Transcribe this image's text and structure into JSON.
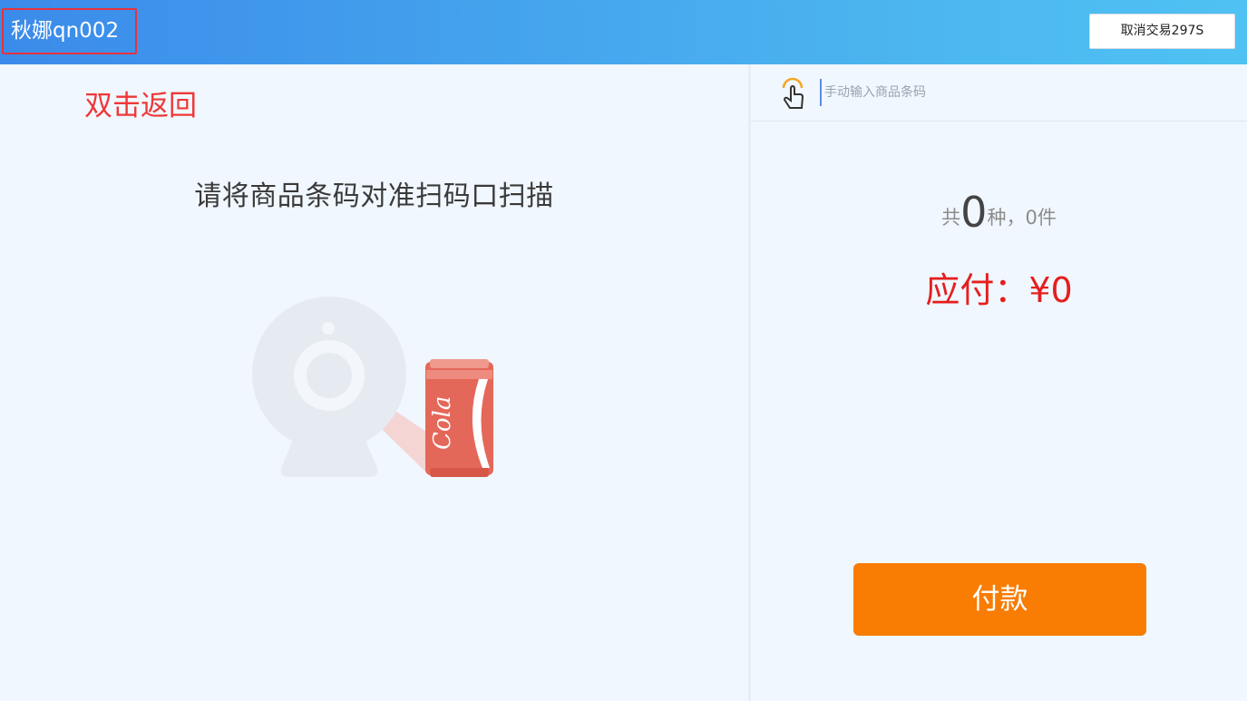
{
  "header": {
    "user_label": "秋娜qn002",
    "cancel_button": "取消交易297S"
  },
  "left": {
    "back_hint": "双击返回",
    "scan_tip": "请将商品条码对准扫码口扫描",
    "can_text": "Cola"
  },
  "right": {
    "barcode_placeholder": "手动输入商品条码",
    "summary": {
      "prefix": "共",
      "kinds": "0",
      "middle": "种，",
      "items": "0",
      "suffix": "件"
    },
    "payable_label": "应付：",
    "payable_amount": "¥0",
    "pay_button": "付款"
  },
  "colors": {
    "header_gradient_start": "#3b8bea",
    "header_gradient_end": "#4fc2f3",
    "payable_red": "#e61e1e",
    "pay_button_orange": "#f97c03",
    "hint_red": "#ee3838"
  },
  "icons": {
    "hand": "touch-hand-icon",
    "camera": "webcam-icon",
    "can": "cola-can-icon"
  }
}
